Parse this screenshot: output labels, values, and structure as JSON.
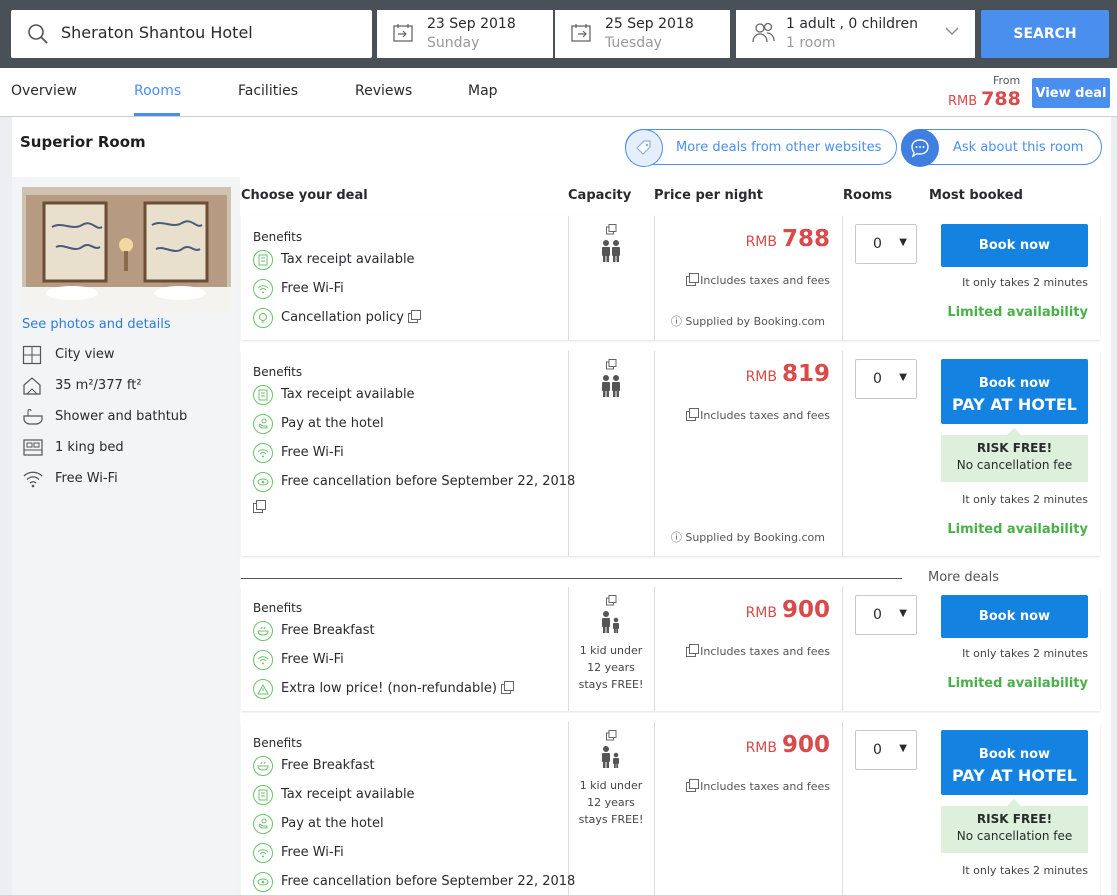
{
  "search": {
    "hotel": "Sheraton Shantou Hotel",
    "checkin_date": "23 Sep 2018",
    "checkin_day": "Sunday",
    "checkout_date": "25 Sep 2018",
    "checkout_day": "Tuesday",
    "guests": "1 adult , 0 children",
    "rooms": "1 room",
    "button": "SEARCH"
  },
  "nav": {
    "tabs": [
      "Overview",
      "Rooms",
      "Facilities",
      "Reviews",
      "Map"
    ],
    "active": "Rooms",
    "from_label": "From",
    "currency": "RMB",
    "from_price": "788",
    "view_deal": "View deal"
  },
  "room": {
    "title": "Superior Room",
    "more_deals_btn": "More deals from other websites",
    "ask_btn": "Ask about this room",
    "see_photos": "See photos and details",
    "amenities": [
      {
        "icon": "city-view-icon",
        "label": "City view"
      },
      {
        "icon": "room-size-icon",
        "label": "35 m²/377 ft²"
      },
      {
        "icon": "bathtub-icon",
        "label": "Shower and bathtub"
      },
      {
        "icon": "bed-icon",
        "label": "1 king bed"
      },
      {
        "icon": "wifi-icon",
        "label": "Free Wi-Fi"
      }
    ]
  },
  "headers": {
    "deal": "Choose your deal",
    "capacity": "Capacity",
    "price": "Price per night",
    "rooms": "Rooms",
    "most_booked": "Most booked"
  },
  "deals": [
    {
      "benefits_label": "Benefits",
      "benefits": [
        "Tax receipt available",
        "Free Wi-Fi",
        "Cancellation policy"
      ],
      "currency": "RMB",
      "price": "788",
      "taxes": "Includes taxes and fees",
      "supplied": "Supplied by Booking.com",
      "qty": "0",
      "book": "Book now",
      "takes": "It only takes 2 minutes",
      "availability": "Limited availability"
    },
    {
      "benefits_label": "Benefits",
      "benefits": [
        "Tax receipt available",
        "Pay at the hotel",
        "Free Wi-Fi",
        "Free cancellation before September 22, 2018"
      ],
      "currency": "RMB",
      "price": "819",
      "taxes": "Includes taxes and fees",
      "supplied": "Supplied by Booking.com",
      "qty": "0",
      "book": "Book now",
      "book_sub": "PAY AT HOTEL",
      "risk_title": "RISK FREE!",
      "risk_sub": "No cancellation fee",
      "takes": "It only takes 2 minutes",
      "availability": "Limited availability"
    },
    {
      "benefits_label": "Benefits",
      "benefits": [
        "Free Breakfast",
        "Free Wi-Fi",
        "Extra low price! (non-refundable)"
      ],
      "kid_note": [
        "1 kid under",
        "12 years",
        "stays FREE!"
      ],
      "currency": "RMB",
      "price": "900",
      "taxes": "Includes taxes and fees",
      "qty": "0",
      "book": "Book now",
      "takes": "It only takes 2 minutes",
      "availability": "Limited availability"
    },
    {
      "benefits_label": "Benefits",
      "benefits": [
        "Free Breakfast",
        "Tax receipt available",
        "Pay at the hotel",
        "Free Wi-Fi",
        "Free cancellation before September 22, 2018"
      ],
      "kid_note": [
        "1 kid under",
        "12 years",
        "stays FREE!"
      ],
      "currency": "RMB",
      "price": "900",
      "taxes": "Includes taxes and fees",
      "qty": "0",
      "book": "Book now",
      "book_sub": "PAY AT HOTEL",
      "risk_title": "RISK FREE!",
      "risk_sub": "No cancellation fee",
      "takes": "It only takes 2 minutes"
    }
  ],
  "more_deals": "More deals",
  "colors": {
    "accent": "#4a8fee",
    "price": "#d94a4a",
    "book": "#1482e0",
    "success": "#4ab04a"
  }
}
